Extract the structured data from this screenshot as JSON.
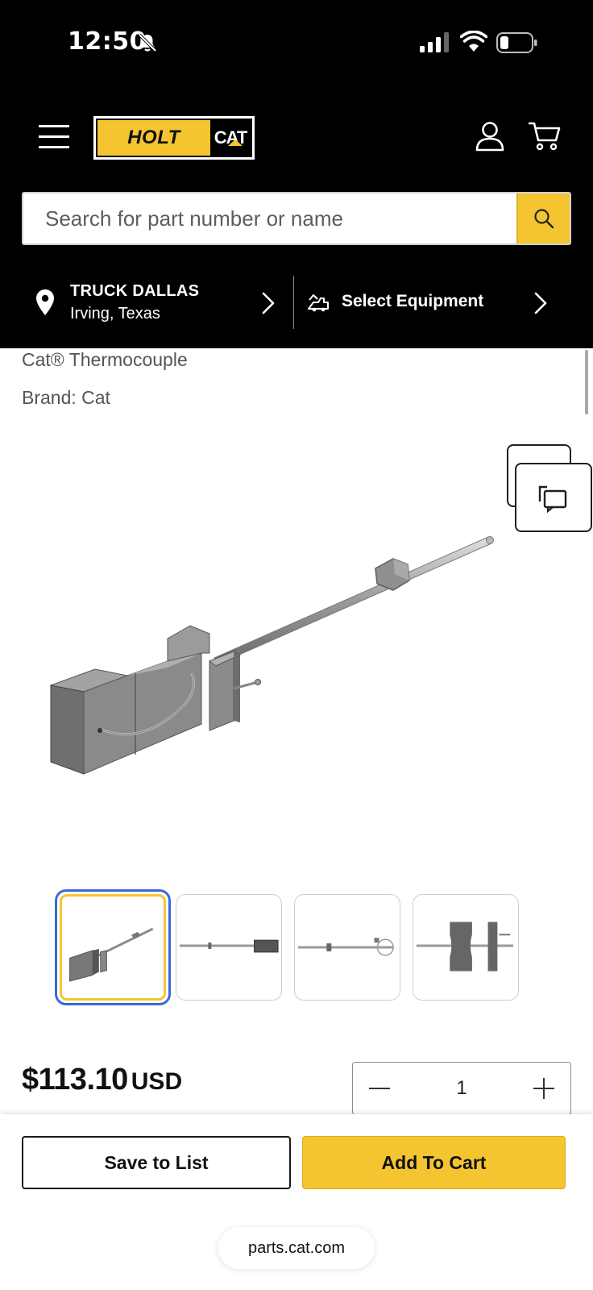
{
  "status_bar": {
    "time": "12:50"
  },
  "header": {
    "logo_left": "HOLT",
    "logo_right": "CAT",
    "search_placeholder": "Search for part number or name"
  },
  "location": {
    "store_name": "TRUCK DALLAS",
    "store_city": "Irving, Texas",
    "equipment_label": "Select Equipment"
  },
  "product": {
    "title": "Cat® Thermocouple",
    "brand": "Brand: Cat",
    "thumbnails": [
      "thumbnail-1",
      "thumbnail-2",
      "thumbnail-3",
      "thumbnail-4"
    ],
    "price": "$113.10",
    "currency": "USD",
    "quantity": "1"
  },
  "actions": {
    "save_label": "Save to List",
    "add_label": "Add To Cart"
  },
  "browser": {
    "url": "parts.cat.com"
  },
  "colors": {
    "accent_yellow": "#F4C531",
    "header_black": "#000000",
    "selected_thumb_border": "#3A6AD8"
  },
  "icons": [
    "bell-slash-icon",
    "signal-icon",
    "wifi-icon",
    "battery-icon",
    "menu-icon",
    "account-icon",
    "cart-icon",
    "search-icon",
    "location-pin-icon",
    "chevron-right-icon",
    "equipment-icon",
    "compare-icon",
    "minus-icon",
    "plus-icon"
  ]
}
